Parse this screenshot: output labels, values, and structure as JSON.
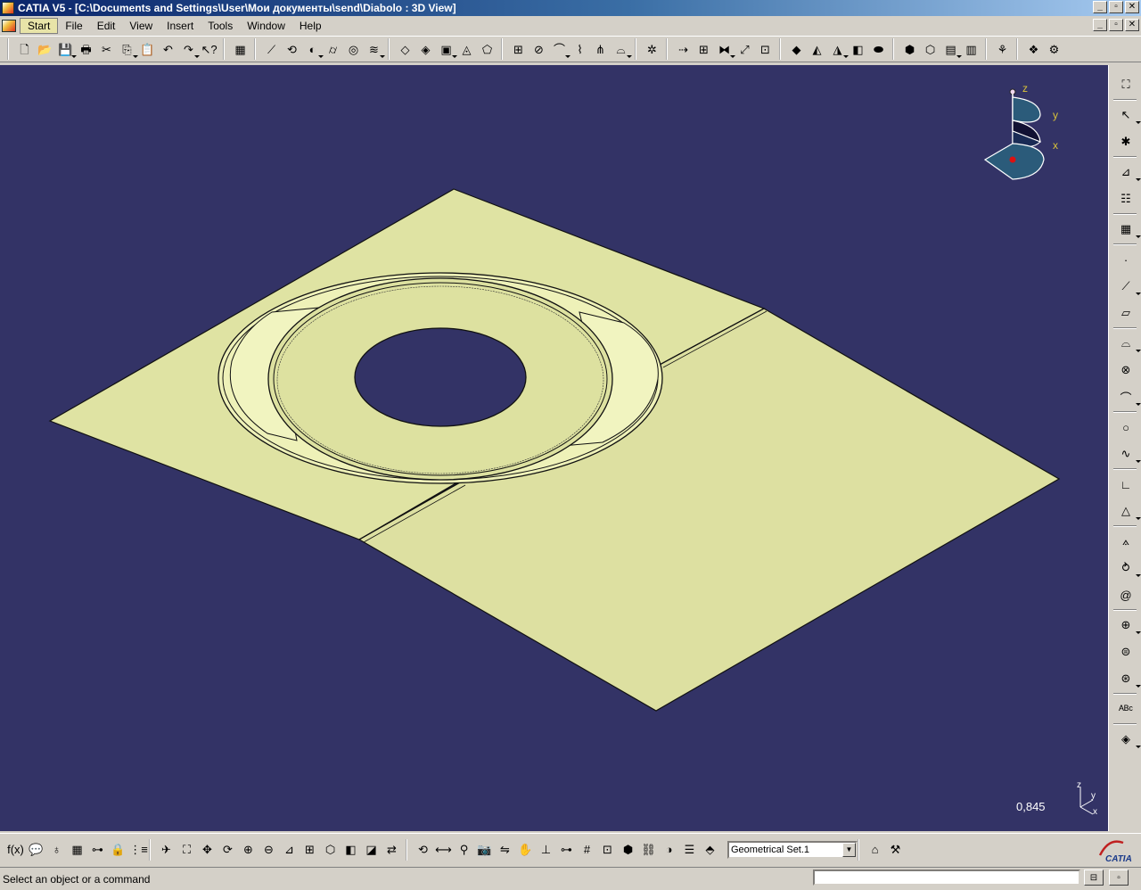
{
  "window": {
    "title": "CATIA V5 - [C:\\Documents and Settings\\User\\Мои документы\\send\\Diabolo : 3D View]",
    "minimize": "_",
    "restore": "▫",
    "close": "✕"
  },
  "menu": {
    "items": [
      {
        "label": "Start",
        "active": true
      },
      {
        "label": "File"
      },
      {
        "label": "Edit"
      },
      {
        "label": "View"
      },
      {
        "label": "Insert"
      },
      {
        "label": "Tools"
      },
      {
        "label": "Window"
      },
      {
        "label": "Help"
      }
    ]
  },
  "toolbar_top": {
    "groups": [
      [
        {
          "icon": "new-icon",
          "glyph": "🗋"
        },
        {
          "icon": "open-icon",
          "glyph": "📂"
        },
        {
          "icon": "save-icon",
          "glyph": "💾"
        },
        {
          "icon": "print-icon",
          "glyph": "🖶"
        },
        {
          "icon": "cut-icon",
          "glyph": "✂"
        },
        {
          "icon": "copy-icon",
          "glyph": "⎘"
        },
        {
          "icon": "paste-icon",
          "glyph": "📋"
        },
        {
          "icon": "undo-icon",
          "glyph": "↶"
        },
        {
          "icon": "redo-icon",
          "glyph": "↷"
        },
        {
          "icon": "whats-this-icon",
          "glyph": "↖?"
        }
      ],
      [
        {
          "icon": "sketcher-icon",
          "glyph": "▦"
        }
      ],
      [
        {
          "icon": "extrude-icon",
          "glyph": "⟋"
        },
        {
          "icon": "revolve-icon",
          "glyph": "⟲"
        },
        {
          "icon": "sphere-icon",
          "glyph": "◐"
        },
        {
          "icon": "cylinder-icon",
          "glyph": "⌭"
        },
        {
          "icon": "offset-icon",
          "glyph": "◎"
        },
        {
          "icon": "sweep-icon",
          "glyph": "≋"
        }
      ],
      [
        {
          "icon": "fill-icon",
          "glyph": "◇"
        },
        {
          "icon": "multisection-icon",
          "glyph": "◈"
        },
        {
          "icon": "blend-icon",
          "glyph": "▣"
        },
        {
          "icon": "loft-icon",
          "glyph": "◬"
        },
        {
          "icon": "surface-icon",
          "glyph": "⬠"
        }
      ],
      [
        {
          "icon": "join-icon",
          "glyph": "⊞"
        },
        {
          "icon": "split-icon",
          "glyph": "⊘"
        },
        {
          "icon": "trim-icon",
          "glyph": "⌒"
        },
        {
          "icon": "boundary-icon",
          "glyph": "⌇"
        },
        {
          "icon": "extract-icon",
          "glyph": "⋔"
        },
        {
          "icon": "fillet-icon",
          "glyph": "⌓"
        }
      ],
      [
        {
          "icon": "transform-icon",
          "glyph": "✲"
        }
      ],
      [
        {
          "icon": "translate-icon",
          "glyph": "⇢"
        },
        {
          "icon": "pattern-icon",
          "glyph": "⊞"
        },
        {
          "icon": "symmetry-icon",
          "glyph": "⧓"
        },
        {
          "icon": "scale-icon",
          "glyph": "⤢"
        },
        {
          "icon": "affinity-icon",
          "glyph": "⊡"
        }
      ],
      [
        {
          "icon": "analysis-icon",
          "glyph": "◆"
        },
        {
          "icon": "draft-analysis-icon",
          "glyph": "◭"
        },
        {
          "icon": "curvature-icon",
          "glyph": "◮"
        },
        {
          "icon": "distance-icon",
          "glyph": "◧"
        },
        {
          "icon": "connect-icon",
          "glyph": "⬬"
        }
      ],
      [
        {
          "icon": "view-iso-icon",
          "glyph": "⬢"
        },
        {
          "icon": "view-front-icon",
          "glyph": "⬡"
        },
        {
          "icon": "view-top-icon",
          "glyph": "▤"
        },
        {
          "icon": "view-side-icon",
          "glyph": "▥"
        }
      ],
      [
        {
          "icon": "knowledge-icon",
          "glyph": "⚘"
        }
      ],
      [
        {
          "icon": "catalog-icon",
          "glyph": "❖"
        },
        {
          "icon": "instantiate-icon",
          "glyph": "⚙"
        }
      ]
    ]
  },
  "viewport": {
    "background": "#333366",
    "surface_fill": "#dfe3a3",
    "compass": {
      "z": "z",
      "y": "y",
      "x": "x"
    },
    "mini_axis": {
      "z": "z",
      "y": "y",
      "x": "x"
    },
    "zoom_value": "0,845"
  },
  "toolbar_right": {
    "items": [
      {
        "icon": "select-mode-icon",
        "glyph": "⛶"
      },
      {
        "icon": "select-arrow-icon",
        "glyph": "↖"
      },
      {
        "icon": "snap-icon",
        "glyph": "✱"
      },
      {
        "icon": "sketch-icon",
        "glyph": "⊿"
      },
      {
        "icon": "copy-list-icon",
        "glyph": "☷"
      },
      {
        "icon": "body-icon",
        "glyph": "▦"
      },
      {
        "icon": "point-icon",
        "glyph": "·"
      },
      {
        "icon": "line-icon",
        "glyph": "⟋"
      },
      {
        "icon": "plane-icon",
        "glyph": "▱"
      },
      {
        "icon": "projection-icon",
        "glyph": "⌓"
      },
      {
        "icon": "intersection-icon",
        "glyph": "⊗"
      },
      {
        "icon": "parallel-curve-icon",
        "glyph": "⌒"
      },
      {
        "icon": "circle-icon",
        "glyph": "○"
      },
      {
        "icon": "spline-icon",
        "glyph": "∿"
      },
      {
        "icon": "corner-icon",
        "glyph": "∟"
      },
      {
        "icon": "extremum-icon",
        "glyph": "△"
      },
      {
        "icon": "polyline-icon",
        "glyph": "⟑"
      },
      {
        "icon": "helix-icon",
        "glyph": "⥁"
      },
      {
        "icon": "spiral-icon",
        "glyph": "@"
      },
      {
        "icon": "law-icon",
        "glyph": "⊕"
      },
      {
        "icon": "blend-curve-icon",
        "glyph": "⊜"
      },
      {
        "icon": "reflect-line-icon",
        "glyph": "⊛"
      },
      {
        "icon": "annotation-icon",
        "glyph": "ᴬᴮᶜ"
      },
      {
        "icon": "material-icon",
        "glyph": "◈"
      }
    ]
  },
  "toolbar_bottom": {
    "left": [
      {
        "icon": "formula-icon",
        "glyph": "f(x)"
      },
      {
        "icon": "comment-icon",
        "glyph": "💬"
      },
      {
        "icon": "rule-icon",
        "glyph": "♁"
      },
      {
        "icon": "table-icon",
        "glyph": "▦"
      },
      {
        "icon": "tree-icon",
        "glyph": "⊶"
      },
      {
        "icon": "lock-icon",
        "glyph": "🔒"
      },
      {
        "icon": "parameters-icon",
        "glyph": "⋮≡"
      }
    ],
    "view": [
      {
        "icon": "fly-icon",
        "glyph": "✈"
      },
      {
        "icon": "fit-all-icon",
        "glyph": "⛶"
      },
      {
        "icon": "pan-icon",
        "glyph": "✥"
      },
      {
        "icon": "rotate-icon",
        "glyph": "⟳"
      },
      {
        "icon": "zoom-in-icon",
        "glyph": "⊕"
      },
      {
        "icon": "zoom-out-icon",
        "glyph": "⊖"
      },
      {
        "icon": "normal-view-icon",
        "glyph": "⊿"
      },
      {
        "icon": "multi-view-icon",
        "glyph": "⊞"
      },
      {
        "icon": "iso-view-icon",
        "glyph": "⬡"
      },
      {
        "icon": "shading-icon",
        "glyph": "◧"
      },
      {
        "icon": "hide-show-icon",
        "glyph": "◪"
      },
      {
        "icon": "swap-visible-icon",
        "glyph": "⇄"
      }
    ],
    "tools": [
      {
        "icon": "update-icon",
        "glyph": "⟲"
      },
      {
        "icon": "measure-icon",
        "glyph": "⟷"
      },
      {
        "icon": "inertia-icon",
        "glyph": "⚲"
      },
      {
        "icon": "capture-icon",
        "glyph": "📷"
      },
      {
        "icon": "swap-icon",
        "glyph": "⇋"
      },
      {
        "icon": "hand-icon",
        "glyph": "✋"
      },
      {
        "icon": "axis-system-icon",
        "glyph": "⊥"
      },
      {
        "icon": "tree-expand-icon",
        "glyph": "⊶"
      },
      {
        "icon": "grid-icon",
        "glyph": "#"
      },
      {
        "icon": "work-on-support-icon",
        "glyph": "⊡"
      },
      {
        "icon": "cube-icon",
        "glyph": "⬢"
      },
      {
        "icon": "scene-icon",
        "glyph": "⛓"
      },
      {
        "icon": "fly-mode-icon",
        "glyph": "◑"
      },
      {
        "icon": "list-icon",
        "glyph": "☰"
      },
      {
        "icon": "set-icon",
        "glyph": "⬘"
      }
    ],
    "current_set": "Geometrical Set.1",
    "right": [
      {
        "icon": "set-manage-icon",
        "glyph": "⌂"
      },
      {
        "icon": "set-tools-icon",
        "glyph": "⚒"
      }
    ],
    "logo_text": "CATIA"
  },
  "statusbar": {
    "message": "Select an object or a command",
    "btn1": "⊟",
    "btn2": "▫"
  }
}
